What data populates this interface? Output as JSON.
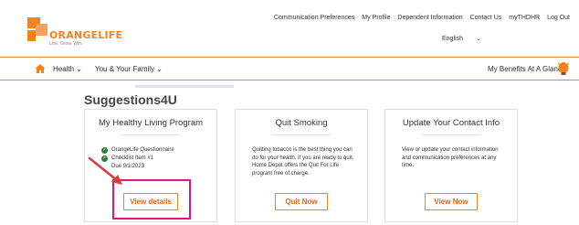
{
  "brand": {
    "name": "ORANGELIFE",
    "tagline": "Live. Grow. Win.",
    "colors": {
      "accent": "#f58220",
      "highlight": "#e0138c",
      "check": "#2e7d32"
    }
  },
  "topnav": {
    "items": [
      "Communication Preferences",
      "My Profile",
      "Dependent Information",
      "Contact Us",
      "myTHDHR",
      "Log Out"
    ]
  },
  "language": {
    "selected": "English"
  },
  "mainnav": {
    "health": "Health ⌄",
    "family": "You & Your Family ⌄",
    "glance": "My Benefits At A Glance"
  },
  "section_title": "Suggestions4U",
  "cards": [
    {
      "title": "My Healthy Living Program",
      "checklist": [
        "OrangeLife Questionnaire",
        "Checklist Item #1"
      ],
      "due": "Due 9/1/2023",
      "button": "View details"
    },
    {
      "title": "Quit Smoking",
      "body": "Quitting tobacco is the best thing you can do for your health. If you are ready to quit, Home Depot offers the Quit For Life program free of charge.",
      "button": "Quit Now"
    },
    {
      "title": "Update Your Contact Info",
      "body": "View or update your contact information and communication preferences at any time.",
      "button": "View Now"
    }
  ],
  "icons": {
    "home": "home-icon",
    "glance": "lightbulb-icon",
    "check": "check-circle-icon",
    "annotation": "red-arrow"
  }
}
